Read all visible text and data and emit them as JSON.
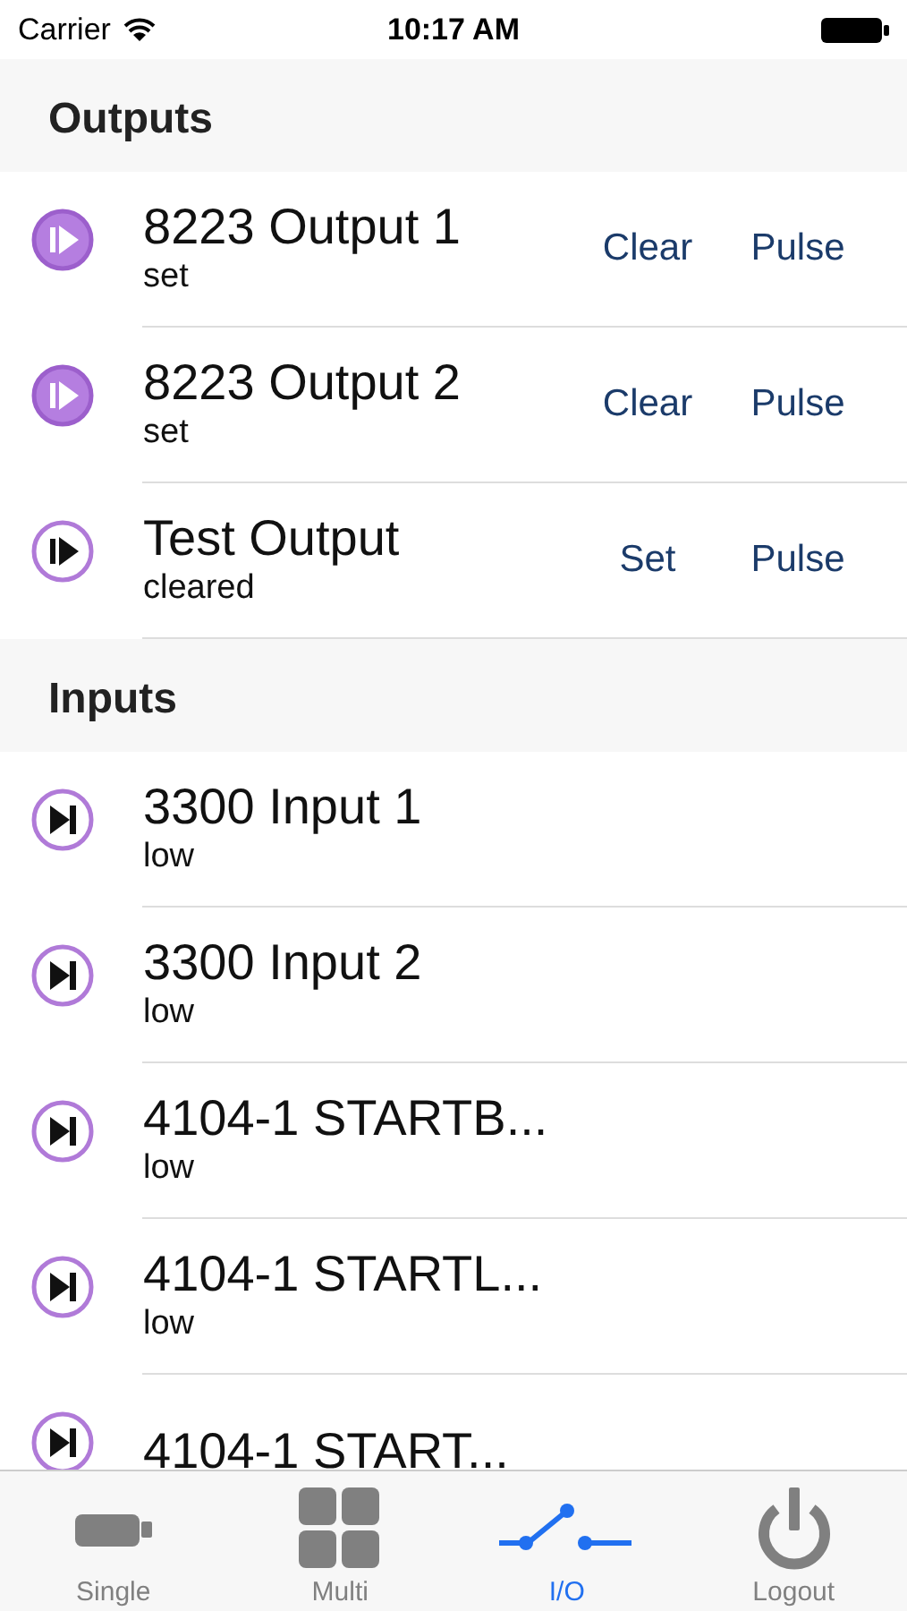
{
  "status_bar": {
    "carrier": "Carrier",
    "time": "10:17 AM"
  },
  "sections": [
    {
      "title": "Outputs",
      "rows": [
        {
          "kind": "output",
          "on": true,
          "name": "8223 Output 1",
          "state": "set",
          "actions": [
            "Clear",
            "Pulse"
          ]
        },
        {
          "kind": "output",
          "on": true,
          "name": "8223 Output 2",
          "state": "set",
          "actions": [
            "Clear",
            "Pulse"
          ]
        },
        {
          "kind": "output",
          "on": false,
          "name": "Test Output",
          "state": "cleared",
          "actions": [
            "Set",
            "Pulse"
          ]
        }
      ]
    },
    {
      "title": "Inputs",
      "rows": [
        {
          "kind": "input",
          "name": "3300 Input 1",
          "state": "low"
        },
        {
          "kind": "input",
          "name": "3300 Input 2",
          "state": "low"
        },
        {
          "kind": "input",
          "name": "4104-1 STARTB...",
          "state": "low"
        },
        {
          "kind": "input",
          "name": "4104-1 STARTL...",
          "state": "low"
        },
        {
          "kind": "input",
          "name": "4104-1 START..."
        }
      ]
    }
  ],
  "tab_bar": [
    {
      "kind": "single",
      "label": "Single",
      "selected": false
    },
    {
      "kind": "multi",
      "label": "Multi",
      "selected": false
    },
    {
      "kind": "io",
      "label": "I/O",
      "selected": true
    },
    {
      "kind": "logout",
      "label": "Logout",
      "selected": false
    }
  ]
}
